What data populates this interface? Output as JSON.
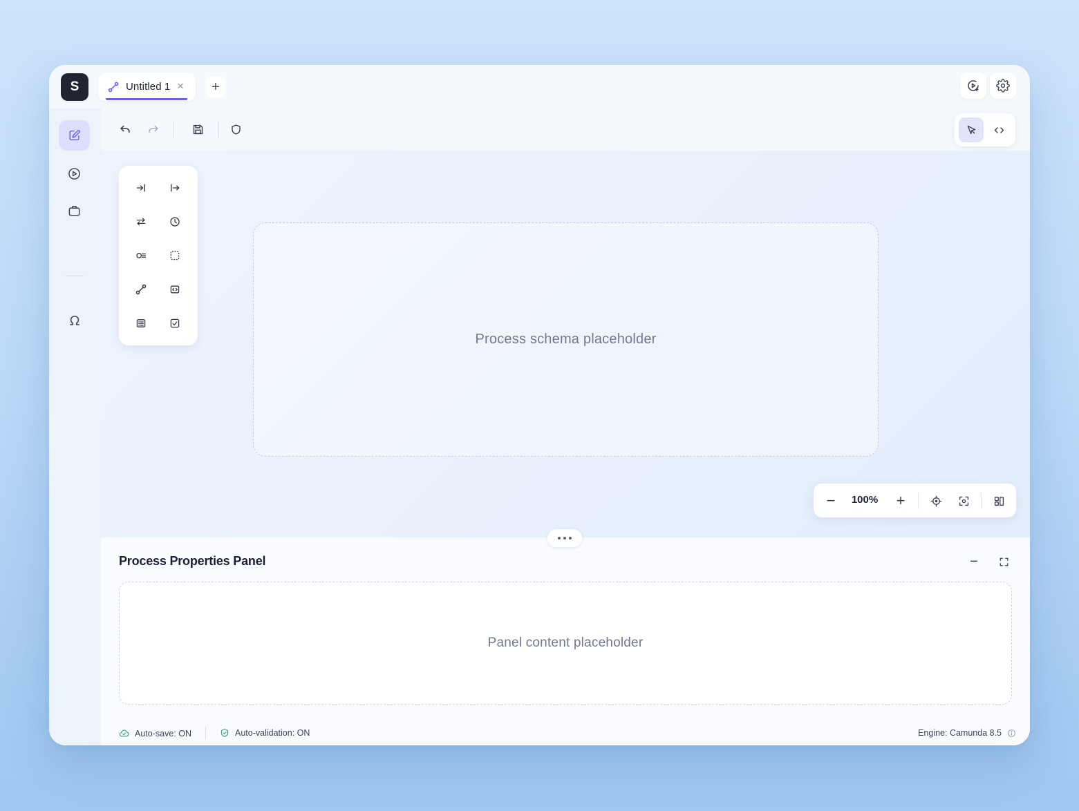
{
  "app": {
    "logo_letter": "S"
  },
  "tabs": [
    {
      "label": "Untitled 1",
      "active": true
    }
  ],
  "topbar": {
    "close_glyph": "×",
    "add_glyph": "+",
    "right_buttons": [
      "preview-icon",
      "settings-icon"
    ]
  },
  "sidebar": {
    "items": [
      {
        "icon": "edit-icon",
        "active": true
      },
      {
        "icon": "play-icon",
        "active": false
      },
      {
        "icon": "briefcase-icon",
        "active": false
      },
      {
        "icon": "omega-icon",
        "active": false
      }
    ]
  },
  "toolbar": {
    "buttons": [
      "undo-icon",
      "redo-icon",
      "save-icon",
      "shield-icon"
    ],
    "modes": [
      {
        "icon": "pointer-icon",
        "active": true
      },
      {
        "icon": "code-icon",
        "active": false
      }
    ]
  },
  "palette": {
    "items": [
      "start-event-icon",
      "end-event-icon",
      "exchange-icon",
      "timer-icon",
      "gateway-icon",
      "selection-icon",
      "connection-icon",
      "script-icon",
      "list-icon",
      "task-icon"
    ]
  },
  "canvas": {
    "placeholder": "Process schema placeholder"
  },
  "zoom": {
    "minus": "−",
    "level": "100%",
    "plus": "+"
  },
  "panel": {
    "title": "Process Properties Panel",
    "placeholder": "Panel content placeholder",
    "minimize_glyph": "−"
  },
  "status": {
    "autosave": "Auto-save: ON",
    "autovalidation": "Auto-validation: ON",
    "engine": "Engine: Camunda 8.5"
  },
  "colors": {
    "accent": "#6a5cf0",
    "ok": "#3aa66e"
  }
}
